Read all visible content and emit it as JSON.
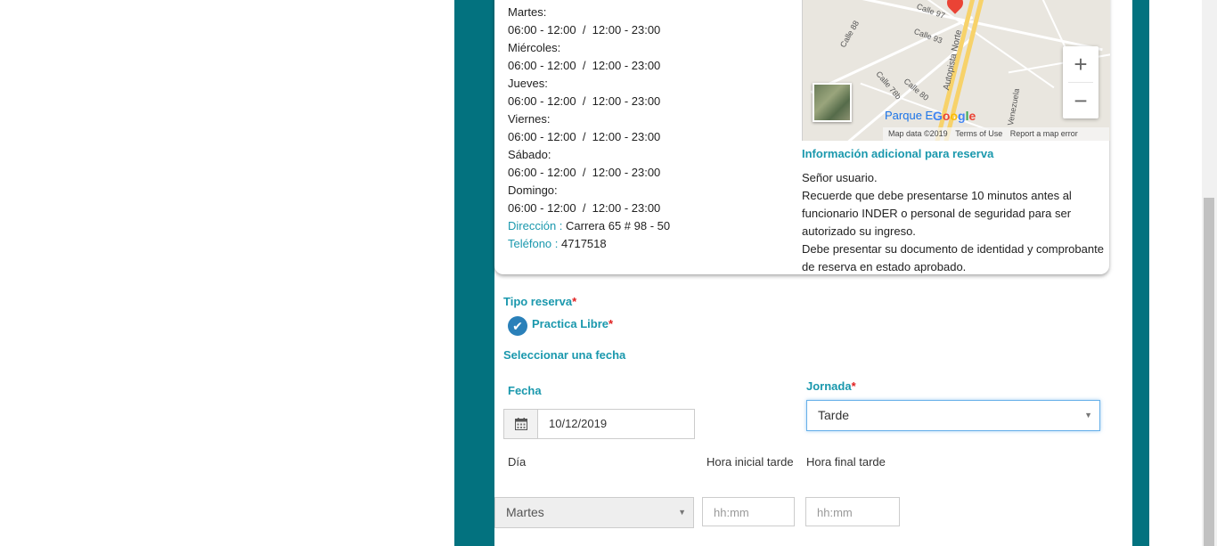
{
  "schedule": [
    {
      "day": "Martes:",
      "hours": "06:00 - 12:00  /  12:00 - 23:00"
    },
    {
      "day": "Miércoles:",
      "hours": "06:00 - 12:00  /  12:00 - 23:00"
    },
    {
      "day": "Jueves:",
      "hours": "06:00 - 12:00  /  12:00 - 23:00"
    },
    {
      "day": "Viernes:",
      "hours": "06:00 - 12:00  /  12:00 - 23:00"
    },
    {
      "day": "Sábado:",
      "hours": "06:00 - 12:00  /  12:00 - 23:00"
    },
    {
      "day": "Domingo:",
      "hours": "06:00 - 12:00  /  12:00 - 23:00"
    }
  ],
  "contact": {
    "address_label": "Dirección :",
    "address_value": "Carrera 65 # 98 - 50",
    "phone_label": "Teléfono :",
    "phone_value": "4717518"
  },
  "map": {
    "labels": [
      "Calle 93",
      "Calle 88",
      "Calle 78b",
      "Calle 80",
      "Calle 97",
      "Autopista Norte",
      "Venezuela"
    ],
    "place_label": "Parque E",
    "google": "Google",
    "footer_data": "Map data ©2019",
    "footer_terms": "Terms of Use",
    "footer_report": "Report a map error",
    "zoom_in": "+",
    "zoom_out": "−"
  },
  "info": {
    "title": "Información adicional para reserva",
    "line1": "Señor usuario.",
    "line2": "Recuerde que debe presentarse 10 minutos antes al funcionario INDER o personal de seguridad para ser autorizado su ingreso.",
    "line3": "Debe presentar su documento de identidad y comprobante de reserva en estado aprobado."
  },
  "form": {
    "tipo_label": "Tipo reserva",
    "required_mark": "*",
    "practica_label": "Practica Libre",
    "seleccionar_label": "Seleccionar una fecha",
    "fecha_label": "Fecha",
    "fecha_value": "10/12/2019",
    "jornada_label": "Jornada",
    "jornada_value": "Tarde",
    "dia_label": "Día",
    "hora_inicial_label": "Hora inicial tarde",
    "hora_final_label": "Hora final tarde",
    "dia_value": "Martes",
    "time_placeholder": "hh:mm"
  }
}
